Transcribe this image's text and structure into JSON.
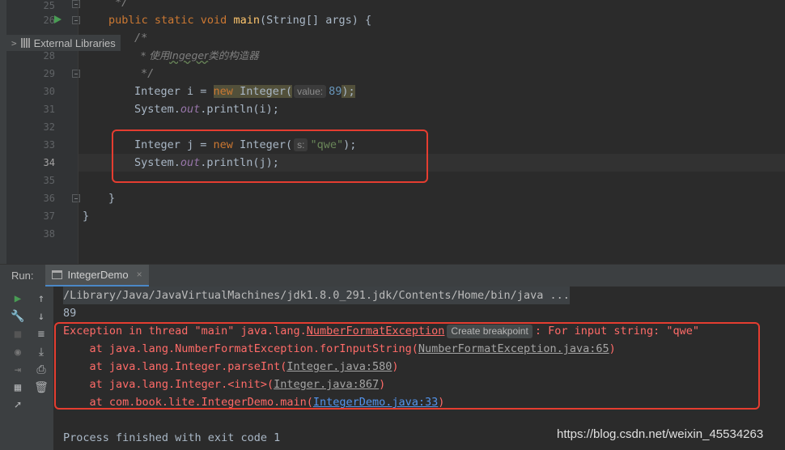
{
  "project": {
    "external_libraries_label": "External Libraries"
  },
  "editor": {
    "line_numbers": [
      "25",
      "26",
      "27",
      "28",
      "29",
      "30",
      "31",
      "32",
      "33",
      "34",
      "35",
      "36",
      "37",
      "38"
    ],
    "lines": {
      "l25": "*/",
      "l26_mod": "public static void",
      "l26_name": "main",
      "l26_rest": "(String[] args) {",
      "l27": "/*",
      "l28_star": "* 使用",
      "l28_word": "Ingeger",
      "l28_rest": "类的构造器",
      "l29": "*/",
      "l30_a": "Integer i = ",
      "l30_new": "new",
      "l30_b": " Integer(",
      "l30_hint": "value:",
      "l30_num": "89",
      "l30_c": ");",
      "l31_a": "System.",
      "l31_out": "out",
      "l31_b": ".println(i);",
      "l33_a": "Integer j = ",
      "l33_new": "new",
      "l33_b": " Integer(",
      "l33_hint": "s:",
      "l33_str": "\"qwe\"",
      "l33_c": ");",
      "l34_a": "System.",
      "l34_out": "out",
      "l34_b": ".println(j);",
      "l36": "}",
      "l37": "}"
    }
  },
  "run_panel": {
    "label": "Run:",
    "tab_title": "IntegerDemo",
    "tab_close": "×"
  },
  "console": {
    "cmd": "/Library/Java/JavaVirtualMachines/jdk1.8.0_291.jdk/Contents/Home/bin/java ...",
    "out1": "89",
    "exc_prefix": "Exception in thread \"main\" java.lang.",
    "exc_class": "NumberFormatException",
    "create_breakpoint": "Create breakpoint",
    "exc_msg": ": For input string: \"qwe\"",
    "st1_a": "    at java.lang.NumberFormatException.forInputString(",
    "st1_link": "NumberFormatException.java:65",
    "st1_b": ")",
    "st2_a": "    at java.lang.Integer.parseInt(",
    "st2_link": "Integer.java:580",
    "st2_b": ")",
    "st3_a": "    at java.lang.Integer.<init>(",
    "st3_link": "Integer.java:867",
    "st3_b": ")",
    "st4_a": "    at com.book.lite.IntegerDemo.main(",
    "st4_link": "IntegerDemo.java:33",
    "st4_b": ")",
    "exit": "Process finished with exit code 1"
  },
  "watermark": "https://blog.csdn.net/weixin_45534263",
  "colors": {
    "keyword": "#cc7832",
    "method": "#ffc66d",
    "error": "#ff6b68",
    "link": "#5394ec",
    "highlight_box": "#e53d30"
  },
  "icons": {
    "run": "play-icon",
    "rerun": "wrench-icon",
    "up": "arrow-up-icon",
    "down": "arrow-down-icon",
    "wrap": "soft-wrap-icon",
    "scroll": "scroll-to-end-icon",
    "print": "print-icon",
    "trash": "trash-icon"
  }
}
